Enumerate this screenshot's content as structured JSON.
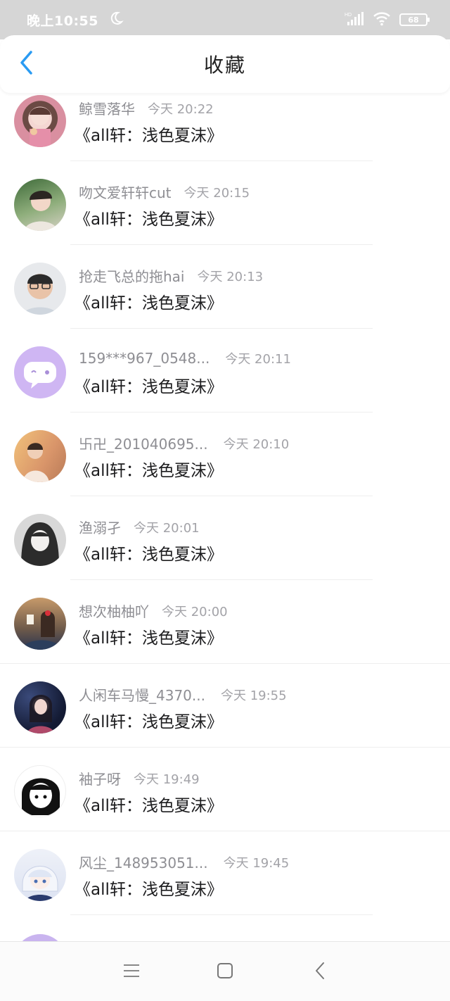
{
  "status_bar": {
    "time": "晚上10:55",
    "battery": "68",
    "icons": [
      "moon-icon",
      "signal-hd-icon",
      "wifi-icon",
      "battery-icon"
    ]
  },
  "header": {
    "title": "收藏",
    "back_icon": "chevron-left-icon"
  },
  "colors": {
    "accent": "#2a9bf2",
    "status_bar_bg": "#d6d6d6",
    "meta_text": "#8e8e93",
    "title_text": "#1c1c1e"
  },
  "items": [
    {
      "author": "鲸雪落华",
      "time": "今天 20:22",
      "title": "《all轩：浅色夏沫》"
    },
    {
      "author": "吻文爱轩轩cut",
      "time": "今天 20:15",
      "title": "《all轩：浅色夏沫》"
    },
    {
      "author": "抢走飞总的拖hai",
      "time": "今天 20:13",
      "title": "《all轩：浅色夏沫》"
    },
    {
      "author": "159***967_0548...",
      "time": "今天 20:11",
      "title": "《all轩：浅色夏沫》"
    },
    {
      "author": "卐卍_201040695...",
      "time": "今天 20:10",
      "title": "《all轩：浅色夏沫》"
    },
    {
      "author": "渔溺孑",
      "time": "今天 20:01",
      "title": "《all轩：浅色夏沫》"
    },
    {
      "author": "想次柚柚吖",
      "time": "今天 20:00",
      "title": "《all轩：浅色夏沫》"
    },
    {
      "author": "人闲车马慢_4370...",
      "time": "今天 19:55",
      "title": "《all轩：浅色夏沫》"
    },
    {
      "author": "袖子呀",
      "time": "今天 19:49",
      "title": "《all轩：浅色夏沫》"
    },
    {
      "author": "风尘_148953051...",
      "time": "今天 19:45",
      "title": "《all轩：浅色夏沫》"
    }
  ],
  "nav_bar": {
    "icons": [
      "menu-icon",
      "home-square-icon",
      "back-triangle-icon"
    ]
  }
}
